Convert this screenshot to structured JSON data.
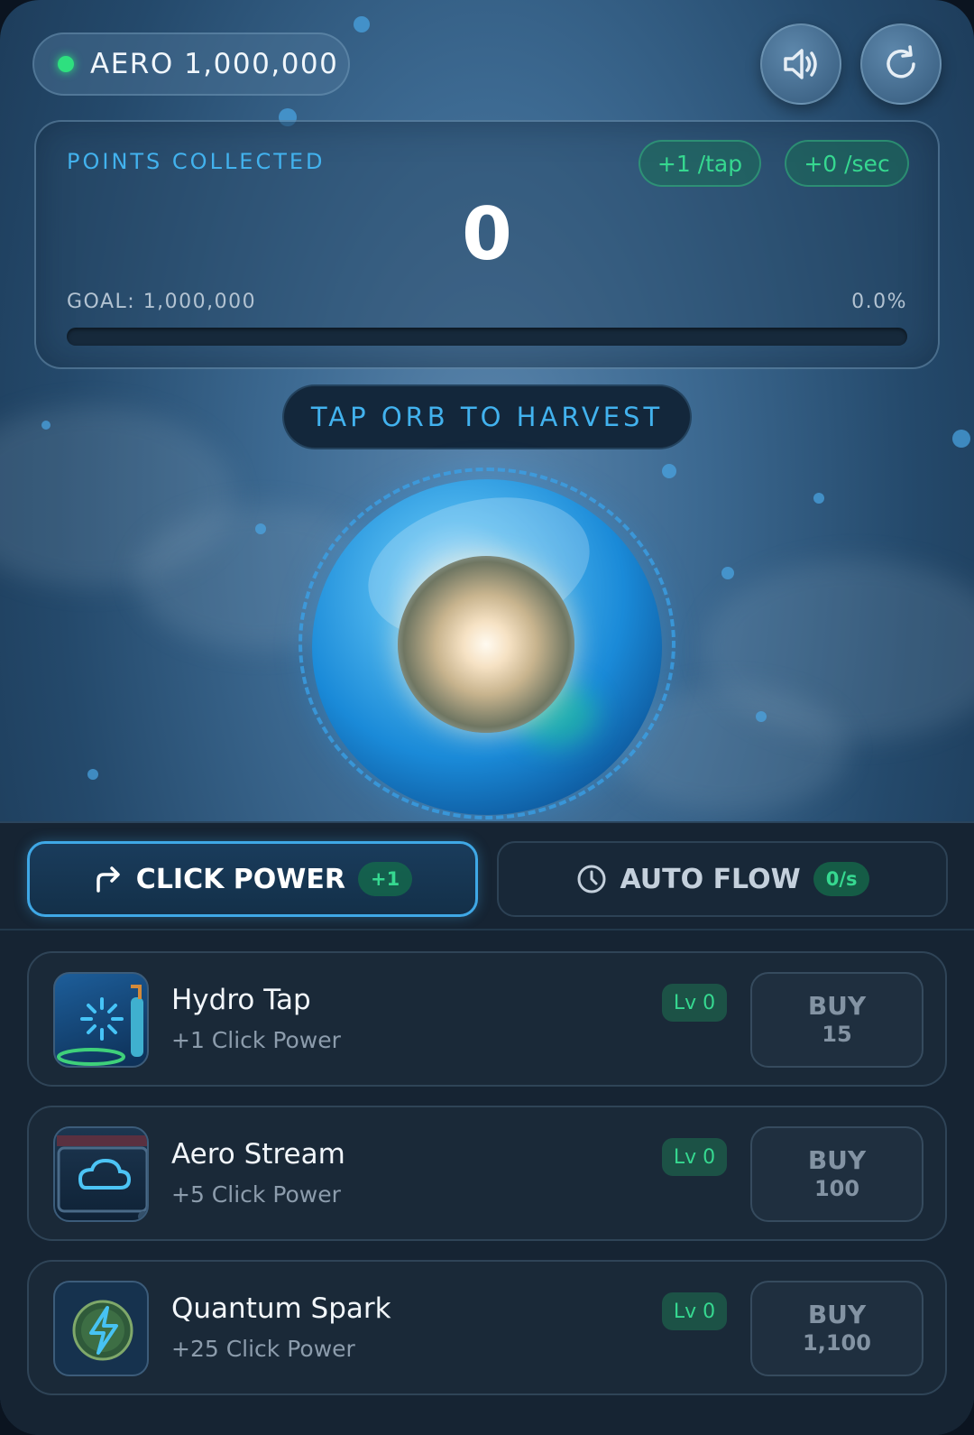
{
  "header": {
    "balance_label": "AERO 1,000,000",
    "status_color": "#2ee07f"
  },
  "icons": {
    "sound": "speaker-icon",
    "reset": "refresh-icon",
    "click_power": "redo-arrow-icon",
    "auto_flow": "clock-icon"
  },
  "points": {
    "label": "POINTS COLLECTED",
    "per_tap": "+1 /tap",
    "per_sec": "+0 /sec",
    "value": "0",
    "goal": "GOAL: 1,000,000",
    "percent": "0.0%",
    "progress_fraction": 0.0
  },
  "hint": "TAP ORB TO HARVEST",
  "tabs": [
    {
      "label": "CLICK POWER",
      "badge": "+1",
      "active": true
    },
    {
      "label": "AUTO FLOW",
      "badge": "0/s",
      "active": false
    }
  ],
  "upgrades": [
    {
      "name": "Hydro Tap",
      "desc": "+1 Click Power",
      "level": "Lv 0",
      "buy": "BUY",
      "cost": "15",
      "icon": "hydro-tap-icon"
    },
    {
      "name": "Aero Stream",
      "desc": "+5 Click Power",
      "level": "Lv 0",
      "buy": "BUY",
      "cost": "100",
      "icon": "cloud-icon"
    },
    {
      "name": "Quantum Spark",
      "desc": "+25 Click Power",
      "level": "Lv 0",
      "buy": "BUY",
      "cost": "1,100",
      "icon": "lightning-icon"
    }
  ],
  "colors": {
    "accent_blue": "#42b2ee",
    "accent_green": "#36d890",
    "panel": "#162433"
  }
}
